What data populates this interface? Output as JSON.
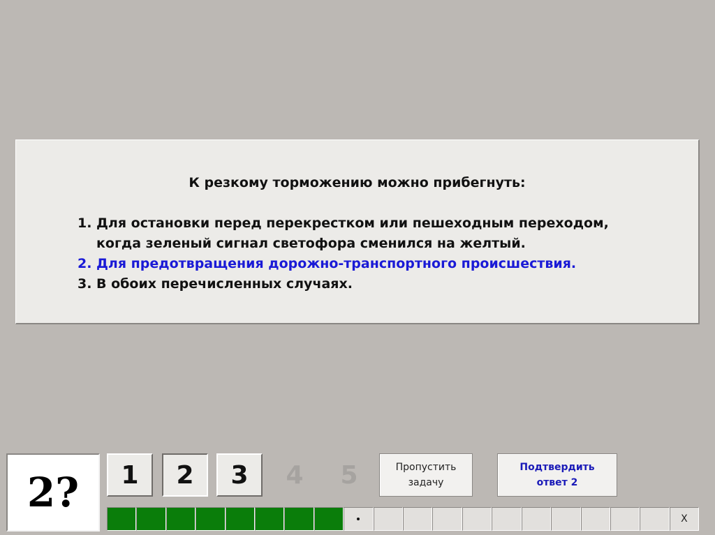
{
  "question": {
    "title": "К резкому торможению можно прибегнуть:",
    "answers": [
      {
        "num": "1.",
        "text": "Для остановки перед перекрестком или пешеходным переходом,\nкогда зеленый сигнал светофора сменился на желтый."
      },
      {
        "num": "2.",
        "text": "Для предотвращения дорожно-транспортного происшествия."
      },
      {
        "num": "3.",
        "text": "В обоих перечисленных случаях."
      }
    ],
    "selected_color": "#1a1ad6"
  },
  "status": {
    "label": "2?"
  },
  "answer_buttons": [
    "1",
    "2",
    "3",
    "4",
    "5"
  ],
  "actions": {
    "skip_label": "Пропустить\nзадачу",
    "confirm_label": "Подтвердить\nответ 2"
  },
  "progress": {
    "total": 20,
    "completed": 8,
    "close_label": "X",
    "done_color": "#0a7d0a"
  }
}
